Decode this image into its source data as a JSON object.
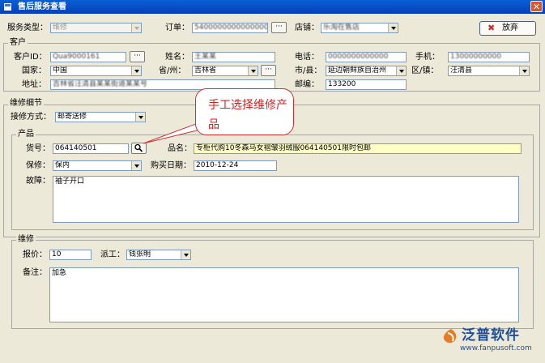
{
  "window": {
    "title": "售后服务查看",
    "close_glyph": "✕"
  },
  "top": {
    "service_type_label": "服务类型：",
    "service_type_value": "维修",
    "order_label": "订单：",
    "order_value": "5400000000000000",
    "store_label": "店铺：",
    "store_value": "乐淘在售店",
    "exit_button": "放弃",
    "exit_icon": "✖",
    "browse_button": "···"
  },
  "customer": {
    "group_title": "客户",
    "id_label": "客户ID：",
    "id_value": "Qua9000161",
    "name_label": "姓名：",
    "name_value": "王某某",
    "phone_label": "电话：",
    "phone_value": "0000000000000",
    "mobile_label": "手机：",
    "mobile_value": "13000000000",
    "country_label": "国家：",
    "country_value": "中国",
    "province_label": "省/州：",
    "province_value": "吉林省",
    "city_label": "市/县：",
    "city_value": "延边朝鲜族自治州",
    "district_label": "区/镇：",
    "district_value": "汪清县",
    "address_label": "地址：",
    "address_value": "吉林省汪清县某某街道某某号",
    "zip_label": "邮编：",
    "zip_value": "133200"
  },
  "repair_detail": {
    "group_title": "维修细节",
    "method_label": "接修方式：",
    "method_value": "邮寄送修"
  },
  "product": {
    "group_title": "产品",
    "code_label": "货号：",
    "code_value": "064140501",
    "name_label": "品名：",
    "name_value": "专柜代购10冬森马女褶皱羽绒服064140501限时包邮",
    "warranty_label": "保修：",
    "warranty_value": "保内",
    "purchase_label": "购买日期：",
    "purchase_value": "2010-12-24",
    "fault_label": "故障：",
    "fault_value": "袖子开口"
  },
  "repair": {
    "group_title": "维修",
    "quote_label": "报价：",
    "quote_value": "10",
    "worker_label": "派工：",
    "worker_value": "钱张明",
    "remark_label": "备注：",
    "remark_value": "加急"
  },
  "callout": {
    "text": "手工选择维修产品"
  },
  "logo": {
    "brand": "泛普软件",
    "url": "www.fanpusoft.com"
  },
  "colors": {
    "title_bar": "#0a5fd6",
    "callout_red": "#d32020",
    "brand_blue": "#1e4f9f",
    "highlight_yellow": "#ffffc8"
  }
}
